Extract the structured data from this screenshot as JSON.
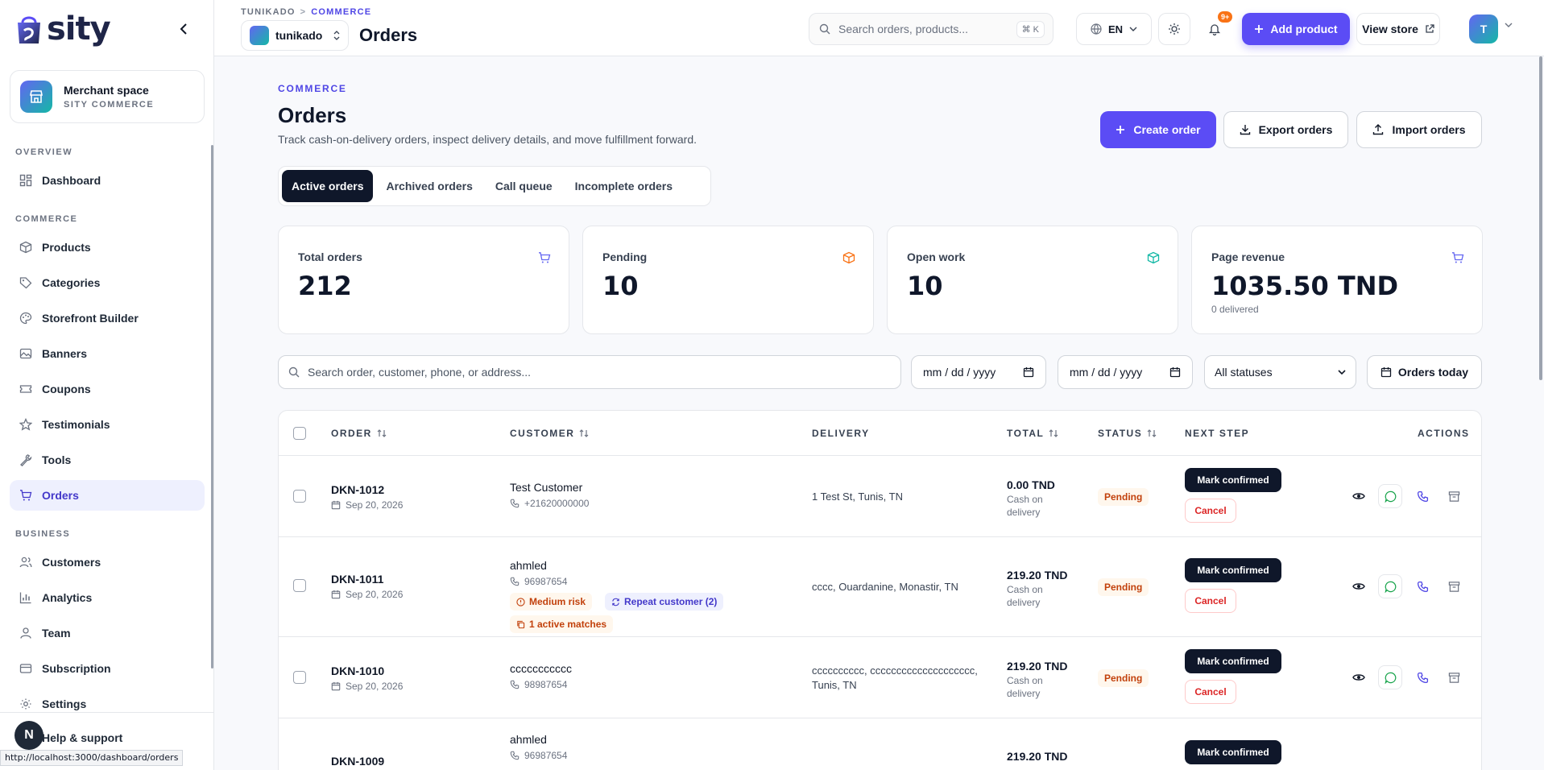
{
  "brand": {
    "name": "sity"
  },
  "merchant": {
    "title": "Merchant space",
    "subtitle": "SITY COMMERCE"
  },
  "nav": {
    "sections": [
      "OVERVIEW",
      "COMMERCE",
      "BUSINESS"
    ],
    "items": [
      {
        "label": "Dashboard"
      },
      {
        "label": "Products"
      },
      {
        "label": "Categories"
      },
      {
        "label": "Storefront Builder"
      },
      {
        "label": "Banners"
      },
      {
        "label": "Coupons"
      },
      {
        "label": "Testimonials"
      },
      {
        "label": "Tools"
      },
      {
        "label": "Orders"
      },
      {
        "label": "Customers"
      },
      {
        "label": "Analytics"
      },
      {
        "label": "Team"
      },
      {
        "label": "Subscription"
      },
      {
        "label": "Settings"
      },
      {
        "label": "Help & support"
      }
    ]
  },
  "status_bar": {
    "url": "http://localhost:3000/dashboard/orders",
    "dev_badge": "N"
  },
  "header": {
    "crumb_root": "TUNIKADO",
    "crumb_sep": ">",
    "crumb_current": "COMMERCE",
    "store": "tunikado",
    "title": "Orders",
    "search_placeholder": "Search orders, products...",
    "search_shortcut": "⌘ K",
    "language": "EN",
    "notifications": "9+",
    "add_product": "Add product",
    "view_store": "View store",
    "user_initial": "T"
  },
  "page": {
    "eyebrow": "COMMERCE",
    "title": "Orders",
    "description": "Track cash-on-delivery orders, inspect delivery details, and move fulfillment forward.",
    "create_order": "Create order",
    "export_orders": "Export orders",
    "import_orders": "Import orders"
  },
  "tabs": [
    "Active orders",
    "Archived orders",
    "Call queue",
    "Incomplete orders"
  ],
  "stats": [
    {
      "label": "Total orders",
      "value": "212",
      "color": "#6366f1"
    },
    {
      "label": "Pending",
      "value": "10",
      "color": "#f97316"
    },
    {
      "label": "Open work",
      "value": "10",
      "color": "#14b8a6"
    },
    {
      "label": "Page revenue",
      "value": "1035.50 TND",
      "sub": "0 delivered",
      "color": "#6366f1"
    }
  ],
  "filters": {
    "search_placeholder": "Search order, customer, phone, or address...",
    "date_from": "mm / dd / yyyy",
    "date_to": "mm / dd / yyyy",
    "status": "All statuses",
    "orders_today": "Orders today"
  },
  "table": {
    "columns": [
      "ORDER",
      "CUSTOMER",
      "DELIVERY",
      "TOTAL",
      "STATUS",
      "NEXT STEP",
      "ACTIONS"
    ],
    "rows": [
      {
        "id": "DKN-1012",
        "date": "Sep 20, 2026",
        "customer": "Test Customer",
        "phone": "+21620000000",
        "delivery": "1 Test St, Tunis, TN",
        "total": "0.00 TND",
        "payment": "Cash on delivery",
        "status": "Pending",
        "next": "Mark confirmed",
        "cancel": "Cancel"
      },
      {
        "id": "DKN-1011",
        "date": "Sep 20, 2026",
        "customer": "ahmled",
        "phone": "96987654",
        "risk": "Medium risk",
        "repeat": "Repeat customer (2)",
        "matches": "1 active matches",
        "delivery": "cccc, Ouardanine, Monastir, TN",
        "total": "219.20 TND",
        "payment": "Cash on delivery",
        "status": "Pending",
        "next": "Mark confirmed",
        "cancel": "Cancel"
      },
      {
        "id": "DKN-1010",
        "date": "Sep 20, 2026",
        "customer": "ccccccccccc",
        "phone": "98987654",
        "delivery": "cccccccccc, cccccccccccccccccccc, Tunis, TN",
        "total": "219.20 TND",
        "payment": "Cash on delivery",
        "status": "Pending",
        "next": "Mark confirmed",
        "cancel": "Cancel"
      },
      {
        "id": "DKN-1009",
        "customer": "ahmled",
        "phone": "96987654",
        "total": "219.20 TND",
        "next": "Mark confirmed"
      }
    ]
  }
}
